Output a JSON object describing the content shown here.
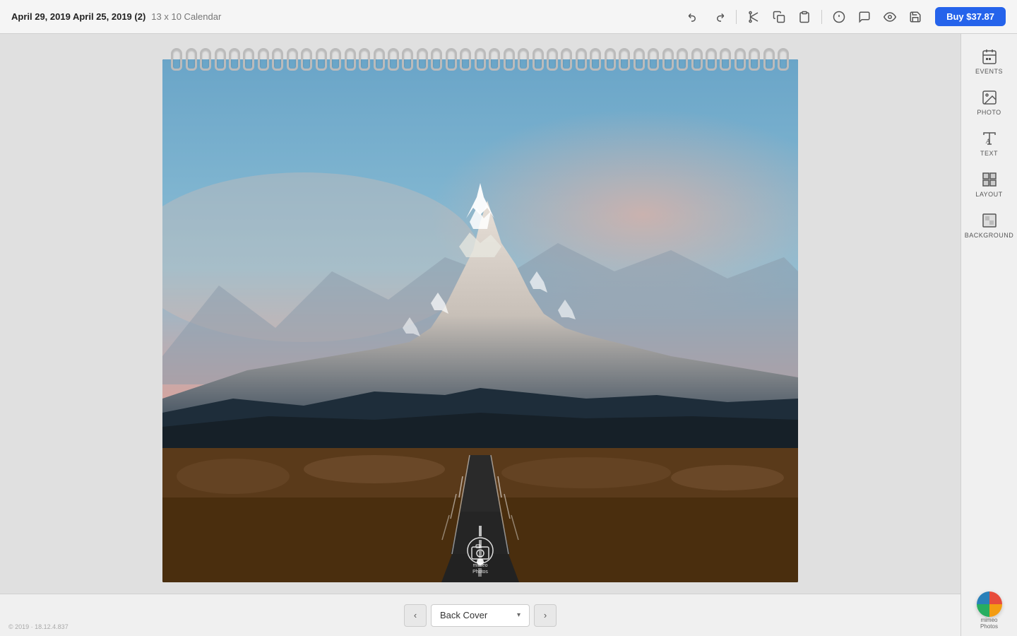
{
  "toolbar": {
    "title_main": "April 29, 2019  April 25, 2019 (2)",
    "title_sub": "13 x 10 Calendar",
    "buy_label": "Buy $37.87",
    "undo_label": "Undo",
    "redo_label": "Redo",
    "cut_label": "Cut",
    "copy_label": "Copy",
    "paste_label": "Paste",
    "info_label": "Info",
    "comment_label": "Comment",
    "preview_label": "Preview",
    "save_label": "Save"
  },
  "sidebar": {
    "items": [
      {
        "id": "events",
        "label": "EVENTS"
      },
      {
        "id": "photo",
        "label": "PHOTO"
      },
      {
        "id": "text",
        "label": "TEXT"
      },
      {
        "id": "layout",
        "label": "LAYOUT"
      },
      {
        "id": "background",
        "label": "BACKGROUND"
      }
    ]
  },
  "canvas": {
    "current_page": "Back Cover",
    "watermark_line1": "mimeo",
    "watermark_line2": "Photos"
  },
  "bottom_bar": {
    "prev_label": "‹",
    "next_label": "›",
    "page_name": "Back Cover",
    "dropdown_arrow": "▾"
  },
  "footer": {
    "copyright": "© 2019 · 18.12.4.837"
  },
  "mimeo_footer": {
    "name": "mimeo",
    "sub": "Photos"
  }
}
